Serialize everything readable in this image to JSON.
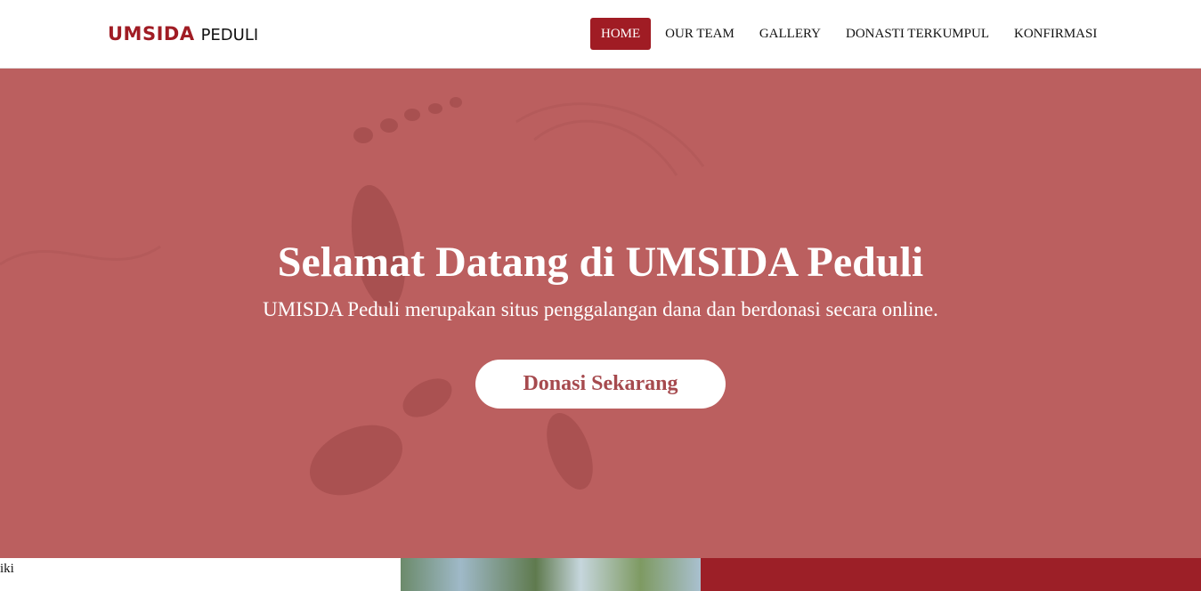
{
  "brand": {
    "main": "UMSIDA",
    "sub": "PEDULI",
    "color": "#a01c24"
  },
  "nav": {
    "items": [
      {
        "label": "HOME",
        "active": true
      },
      {
        "label": "OUR TEAM",
        "active": false
      },
      {
        "label": "GALLERY",
        "active": false
      },
      {
        "label": "DONASTI TERKUMPUL",
        "active": false
      },
      {
        "label": "KONFIRMASI",
        "active": false
      }
    ]
  },
  "hero": {
    "title": "Selamat Datang di UMSIDA Peduli",
    "subtitle": "UMISDA Peduli merupakan situs penggalangan dana dan berdonasi secara online.",
    "button_label": "Donasi Sekarang",
    "overlay_color": "#b85b5b"
  },
  "bottom": {
    "left_text": "iki",
    "accent_color": "#9c1f27"
  }
}
